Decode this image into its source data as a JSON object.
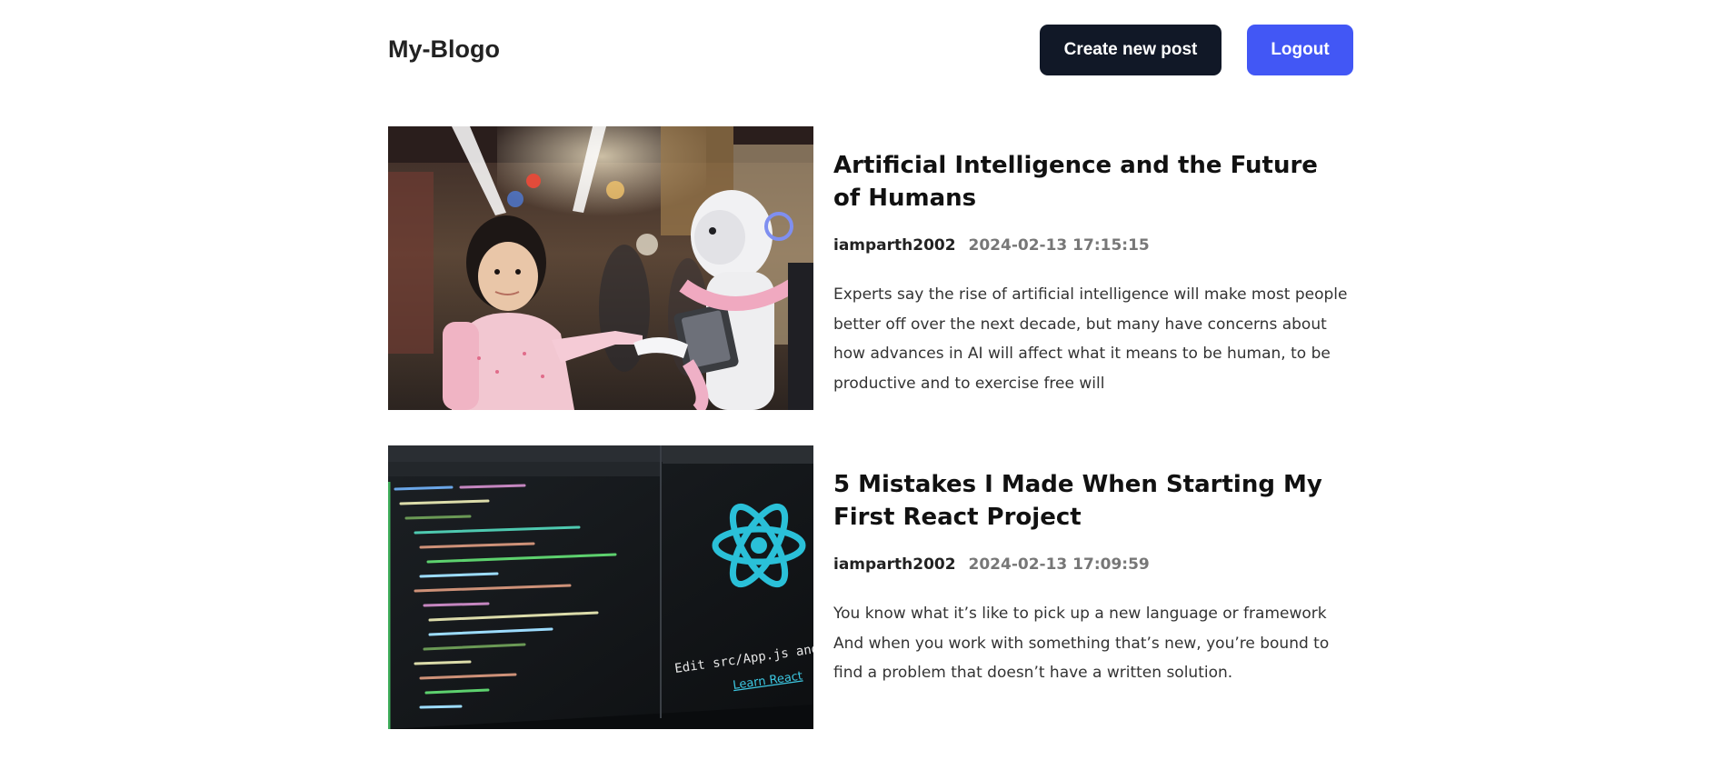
{
  "header": {
    "logo": "My-Blogo",
    "create_label": "Create new post",
    "logout_label": "Logout"
  },
  "colors": {
    "create_button": "#111827",
    "logout_button": "#4257f5",
    "date_text": "#777777"
  },
  "posts": [
    {
      "title": "Artificial Intelligence and the Future of Humans",
      "author": "iamparth2002",
      "date": "2024-02-13 17:15:15",
      "excerpt": "Experts say the rise of artificial intelligence will make most people better off over the next decade, but many have concerns about how advances in AI will affect what it means to be human, to be productive and to exercise free will",
      "image": "child-and-robot-photo"
    },
    {
      "title": "5 Mistakes I Made When Starting My First React Project",
      "author": "iamparth2002",
      "date": "2024-02-13 17:09:59",
      "excerpt": "You know what it’s like to pick up a new language or framework And when you work with something that’s new, you’re bound to find a problem that doesn’t have a written solution.",
      "image": "react-code-editor-photo",
      "image_text": {
        "edit_caption": "Edit src/App.js and save to reload.",
        "link": "Learn React"
      }
    }
  ]
}
